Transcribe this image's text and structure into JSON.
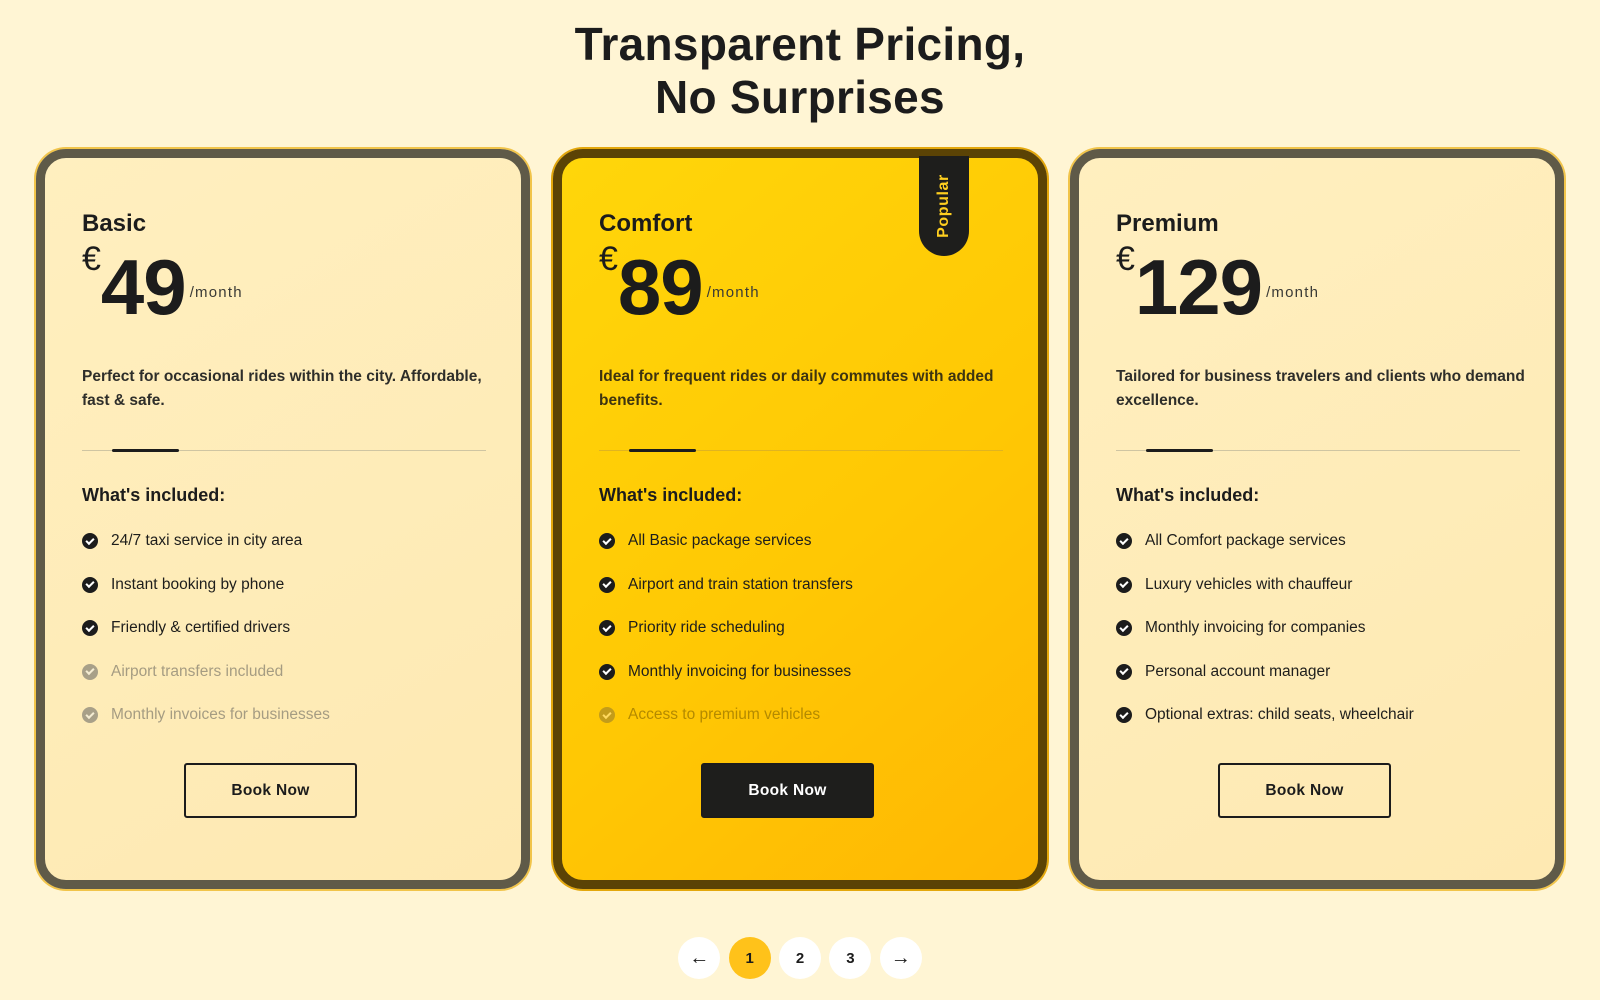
{
  "headline": {
    "line1": "Transparent Pricing,",
    "line2": "No Surprises"
  },
  "plans": [
    {
      "name": "Basic",
      "currency": "€",
      "amount": "49",
      "period": "/month",
      "description": "Perfect for occasional rides within the city. Affordable, fast & safe.",
      "included_title": "What's included:",
      "features": [
        {
          "text": "24/7 taxi service in city area",
          "included": true
        },
        {
          "text": "Instant booking by phone",
          "included": true
        },
        {
          "text": "Friendly & certified drivers",
          "included": true
        },
        {
          "text": "Airport transfers included",
          "included": false
        },
        {
          "text": "Monthly invoices for businesses",
          "included": false
        }
      ],
      "button": "Book Now"
    },
    {
      "name": "Comfort",
      "badge": "Popular",
      "currency": "€",
      "amount": "89",
      "period": "/month",
      "description": "Ideal for frequent rides or daily commutes with added benefits.",
      "included_title": "What's included:",
      "features": [
        {
          "text": "All Basic package services",
          "included": true
        },
        {
          "text": "Airport and train station transfers",
          "included": true
        },
        {
          "text": "Priority ride scheduling",
          "included": true
        },
        {
          "text": "Monthly invoicing for businesses",
          "included": true
        },
        {
          "text": "Access to premium vehicles",
          "included": false
        }
      ],
      "button": "Book Now"
    },
    {
      "name": "Premium",
      "currency": "€",
      "amount": "129",
      "period": "/month",
      "description": "Tailored for business travelers and clients who demand excellence.",
      "included_title": "What's included:",
      "features": [
        {
          "text": "All Comfort package services",
          "included": true
        },
        {
          "text": "Luxury vehicles with chauffeur",
          "included": true
        },
        {
          "text": "Monthly invoicing for companies",
          "included": true
        },
        {
          "text": "Personal account manager",
          "included": true
        },
        {
          "text": "Optional extras: child seats, wheelchair",
          "included": true
        }
      ],
      "button": "Book Now"
    }
  ],
  "pagination": {
    "prev_icon": "←",
    "next_icon": "→",
    "pages": [
      "1",
      "2",
      "3"
    ],
    "current": "1"
  },
  "colors": {
    "background": "#fff5d4",
    "accent": "#ffc21a",
    "featured_card": "#ffcb05",
    "text": "#1c1c1c"
  }
}
